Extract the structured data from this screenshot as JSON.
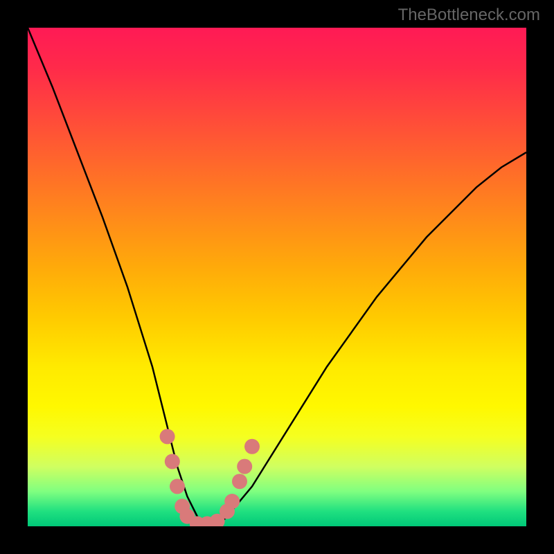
{
  "watermark": "TheBottleneck.com",
  "chart_data": {
    "type": "line",
    "title": "",
    "xlabel": "",
    "ylabel": "",
    "xlim": [
      0,
      100
    ],
    "ylim": [
      0,
      100
    ],
    "series": [
      {
        "name": "bottleneck-curve",
        "x": [
          0,
          5,
          10,
          15,
          20,
          25,
          28,
          30,
          32,
          34,
          36,
          38,
          40,
          45,
          50,
          55,
          60,
          65,
          70,
          75,
          80,
          85,
          90,
          95,
          100
        ],
        "y": [
          100,
          88,
          75,
          62,
          48,
          32,
          20,
          12,
          6,
          2,
          0,
          0,
          2,
          8,
          16,
          24,
          32,
          39,
          46,
          52,
          58,
          63,
          68,
          72,
          75
        ]
      }
    ],
    "markers": {
      "name": "highlight-dots",
      "color": "#d97a7a",
      "points": [
        {
          "x": 28,
          "y": 18
        },
        {
          "x": 29,
          "y": 13
        },
        {
          "x": 30,
          "y": 8
        },
        {
          "x": 31,
          "y": 4
        },
        {
          "x": 32,
          "y": 2
        },
        {
          "x": 34,
          "y": 0.5
        },
        {
          "x": 36,
          "y": 0.5
        },
        {
          "x": 38,
          "y": 1
        },
        {
          "x": 40,
          "y": 3
        },
        {
          "x": 41,
          "y": 5
        },
        {
          "x": 42.5,
          "y": 9
        },
        {
          "x": 43.5,
          "y": 12
        },
        {
          "x": 45,
          "y": 16
        }
      ]
    },
    "gradient_stops": [
      {
        "pos": 0,
        "color": "#ff1a55"
      },
      {
        "pos": 50,
        "color": "#ffca00"
      },
      {
        "pos": 82,
        "color": "#f5ff20"
      },
      {
        "pos": 100,
        "color": "#00c878"
      }
    ]
  }
}
